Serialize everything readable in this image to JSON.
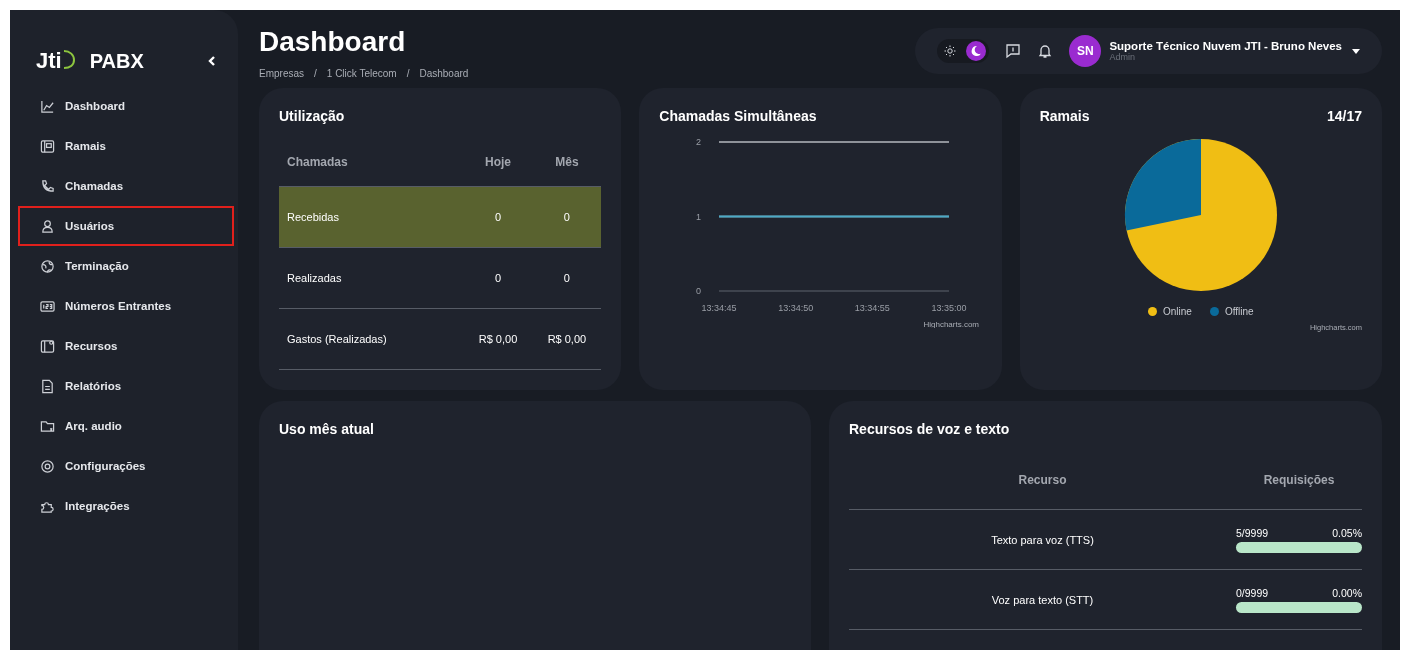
{
  "sidebar": {
    "logo": {
      "brand": "Jti",
      "name": "PABX"
    },
    "items": [
      {
        "kind": "chart",
        "label": "Dashboard",
        "highlighted": false
      },
      {
        "kind": "card",
        "label": "Ramais",
        "highlighted": false
      },
      {
        "kind": "phone",
        "label": "Chamadas",
        "highlighted": false
      },
      {
        "kind": "user",
        "label": "Usuários",
        "highlighted": true
      },
      {
        "kind": "globe",
        "label": "Terminação",
        "highlighted": false
      },
      {
        "kind": "numbers",
        "label": "Números Entrantes",
        "highlighted": false
      },
      {
        "kind": "resources",
        "label": "Recursos",
        "highlighted": false
      },
      {
        "kind": "document",
        "label": "Relatórios",
        "highlighted": false
      },
      {
        "kind": "folder",
        "label": "Arq. audio",
        "highlighted": false
      },
      {
        "kind": "gear",
        "label": "Configurações",
        "highlighted": false
      },
      {
        "kind": "puzzle",
        "label": "Integrações",
        "highlighted": false
      }
    ]
  },
  "header": {
    "title": "Dashboard",
    "breadcrumb": {
      "separator": "/",
      "items": [
        "Empresas",
        "1 Click Telecom",
        "Dashboard"
      ]
    },
    "theme_toggle": [
      {
        "kind": "sun",
        "selected": false
      },
      {
        "kind": "moon",
        "selected": true
      }
    ],
    "user": {
      "initials": "SN",
      "name": "Suporte Técnico Nuvem JTI - Bruno Neves",
      "role": "Admin"
    }
  },
  "usage": {
    "title": "Utilização",
    "columns": [
      "Chamadas",
      "Hoje",
      "Mês"
    ],
    "rows": [
      {
        "cells": [
          "Recebidas",
          "0",
          "0"
        ],
        "selected": true
      },
      {
        "cells": [
          "Realizadas",
          "0",
          "0"
        ],
        "selected": false
      },
      {
        "cells": [
          "Gastos (Realizadas)",
          "R$ 0,00",
          "R$ 0,00"
        ],
        "selected": false
      }
    ]
  },
  "simultaneous": {
    "title": "Chamadas Simultâneas",
    "credit": "Highcharts.com",
    "chart_data": {
      "type": "line",
      "x": [
        "13:34:45",
        "13:34:50",
        "13:34:55",
        "13:35:00"
      ],
      "ylim": [
        0,
        2
      ],
      "yticks": [
        0,
        1,
        2
      ],
      "series": [
        {
          "color": "#4ba9c6",
          "values": [
            1,
            1,
            1,
            1
          ]
        }
      ]
    }
  },
  "extensions": {
    "title": "Ramais",
    "count": "14/17",
    "legend": [
      {
        "label": "Online",
        "color": "#f0be14"
      },
      {
        "label": "Offline",
        "color": "#0a6a9a"
      }
    ],
    "credit": "Highcharts.com"
  },
  "monthly_usage": {
    "title": "Uso mês atual"
  },
  "voice_resources": {
    "title": "Recursos de voz e texto",
    "columns": [
      "Recurso",
      "Requisições"
    ],
    "rows": [
      {
        "resource": "Texto para voz (TTS)",
        "usage": "5/9999",
        "percent": "0.05%",
        "level": 0.0005
      },
      {
        "resource": "Voz para texto (STT)",
        "usage": "0/9999",
        "percent": "0.00%",
        "level": 0
      }
    ]
  }
}
